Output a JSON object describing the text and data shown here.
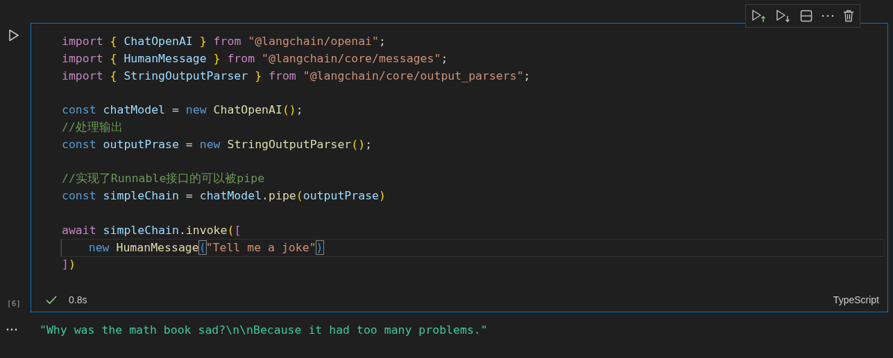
{
  "cell": {
    "execution_count": "[6]",
    "duration": "0.8s",
    "language": "TypeScript",
    "succeeded": true,
    "blocks": [
      [
        {
          "current": false,
          "tokens": [
            {
              "kind": "kw",
              "text": "import"
            },
            {
              "kind": "p1",
              "text": " {"
            },
            {
              "kind": "var",
              "text": " ChatOpenAI"
            },
            {
              "kind": "p1",
              "text": " }"
            },
            {
              "kind": "kw",
              "text": " from"
            },
            {
              "kind": "str",
              "text": " \"@langchain/openai\""
            },
            {
              "kind": "plain",
              "text": ";"
            }
          ]
        },
        {
          "current": false,
          "tokens": [
            {
              "kind": "kw",
              "text": "import"
            },
            {
              "kind": "p1",
              "text": " {"
            },
            {
              "kind": "var",
              "text": " HumanMessage"
            },
            {
              "kind": "p1",
              "text": " }"
            },
            {
              "kind": "kw",
              "text": " from"
            },
            {
              "kind": "str",
              "text": " \"@langchain/core/messages\""
            },
            {
              "kind": "plain",
              "text": ";"
            }
          ]
        },
        {
          "current": false,
          "tokens": [
            {
              "kind": "kw",
              "text": "import"
            },
            {
              "kind": "p1",
              "text": " {"
            },
            {
              "kind": "var",
              "text": " StringOutputParser"
            },
            {
              "kind": "p1",
              "text": " }"
            },
            {
              "kind": "kw",
              "text": " from"
            },
            {
              "kind": "str",
              "text": " \"@langchain/core/output_parsers\""
            },
            {
              "kind": "plain",
              "text": ";"
            }
          ]
        }
      ],
      [
        {
          "current": false,
          "tokens": [
            {
              "kind": "decl",
              "text": "const"
            },
            {
              "kind": "var",
              "text": " chatModel"
            },
            {
              "kind": "plain",
              "text": " ="
            },
            {
              "kind": "decl",
              "text": " new"
            },
            {
              "kind": "fn",
              "text": " ChatOpenAI"
            },
            {
              "kind": "p1",
              "text": "()"
            },
            {
              "kind": "plain",
              "text": ";"
            }
          ]
        },
        {
          "current": false,
          "tokens": [
            {
              "kind": "cmt",
              "text": "//处理输出"
            }
          ]
        },
        {
          "current": false,
          "tokens": [
            {
              "kind": "decl",
              "text": "const"
            },
            {
              "kind": "var",
              "text": " outputPrase"
            },
            {
              "kind": "plain",
              "text": " ="
            },
            {
              "kind": "decl",
              "text": " new"
            },
            {
              "kind": "fn",
              "text": " StringOutputParser"
            },
            {
              "kind": "p1",
              "text": "()"
            },
            {
              "kind": "plain",
              "text": ";"
            }
          ]
        }
      ],
      [
        {
          "current": false,
          "tokens": [
            {
              "kind": "cmt",
              "text": "//实现了Runnable接口的可以被pipe"
            }
          ]
        },
        {
          "current": false,
          "tokens": [
            {
              "kind": "decl",
              "text": "const"
            },
            {
              "kind": "var",
              "text": " simpleChain"
            },
            {
              "kind": "plain",
              "text": " ="
            },
            {
              "kind": "var",
              "text": " chatModel"
            },
            {
              "kind": "plain",
              "text": "."
            },
            {
              "kind": "fn",
              "text": "pipe"
            },
            {
              "kind": "p1",
              "text": "("
            },
            {
              "kind": "var",
              "text": "outputPrase"
            },
            {
              "kind": "p1",
              "text": ")"
            }
          ]
        }
      ],
      [
        {
          "current": false,
          "tokens": [
            {
              "kind": "kw",
              "text": "await"
            },
            {
              "kind": "var",
              "text": " simpleChain"
            },
            {
              "kind": "plain",
              "text": "."
            },
            {
              "kind": "fn",
              "text": "invoke"
            },
            {
              "kind": "p1",
              "text": "("
            },
            {
              "kind": "p2",
              "text": "["
            }
          ]
        },
        {
          "current": true,
          "tokens": [
            {
              "kind": "decl",
              "text": "    new"
            },
            {
              "kind": "fn",
              "text": " HumanMessage"
            },
            {
              "kind": "match",
              "text": "("
            },
            {
              "kind": "str",
              "text": "\"Tell me a joke\""
            },
            {
              "kind": "match",
              "text": ")"
            }
          ]
        },
        {
          "current": false,
          "tokens": [
            {
              "kind": "p2",
              "text": "]"
            },
            {
              "kind": "p1",
              "text": ")"
            }
          ]
        }
      ]
    ]
  },
  "output": {
    "text": "\"Why was the math book sad?\\n\\nBecause it had too many problems.\""
  }
}
